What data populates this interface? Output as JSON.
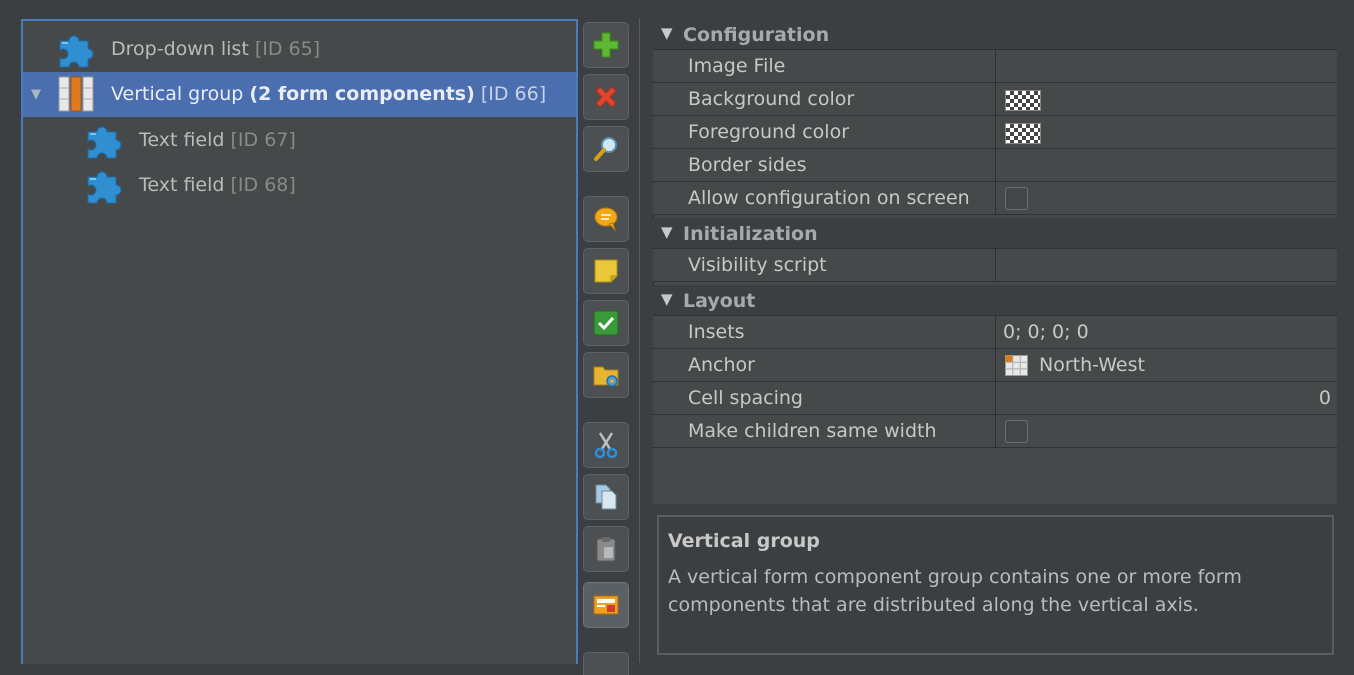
{
  "tree": {
    "items": [
      {
        "label": "Drop-down list",
        "bold": "",
        "id": "[ID 65]",
        "icon": "puzzle-icon",
        "selected": false
      },
      {
        "label": "Vertical group ",
        "bold": "(2 form components)",
        "id": "[ID 66]",
        "icon": "vertical-group-icon",
        "selected": true,
        "expanded": true
      },
      {
        "label": "Text field",
        "bold": "",
        "id": "[ID 67]",
        "icon": "puzzle-icon",
        "selected": false
      },
      {
        "label": "Text field",
        "bold": "",
        "id": "[ID 68]",
        "icon": "puzzle-icon",
        "selected": false
      }
    ]
  },
  "toolbar": {
    "buttons": [
      {
        "name": "add-button",
        "icon": "plus-icon"
      },
      {
        "name": "delete-button",
        "icon": "x-icon"
      },
      {
        "name": "search-button",
        "icon": "magnifier-icon"
      },
      {
        "name": "comment-button",
        "icon": "speech-bubble-icon"
      },
      {
        "name": "note-button",
        "icon": "sticky-note-icon"
      },
      {
        "name": "check-button",
        "icon": "checkmark-icon"
      },
      {
        "name": "folder-button",
        "icon": "folder-gear-icon"
      },
      {
        "name": "cut-button",
        "icon": "scissors-icon"
      },
      {
        "name": "copy-button",
        "icon": "copy-icon"
      },
      {
        "name": "paste-button",
        "icon": "clipboard-icon"
      },
      {
        "name": "screen-button",
        "icon": "form-preview-icon"
      }
    ]
  },
  "properties": {
    "configuration": {
      "title": "Configuration",
      "image_file": "Image File",
      "background_color": "Background color",
      "foreground_color": "Foreground color",
      "border_sides": "Border sides",
      "allow_configuration": "Allow configuration on screen"
    },
    "initialization": {
      "title": "Initialization",
      "visibility_script": "Visibility script"
    },
    "layout": {
      "title": "Layout",
      "insets_label": "Insets",
      "insets_value": "0; 0; 0; 0",
      "anchor_label": "Anchor",
      "anchor_value": "North-West",
      "cell_spacing_label": "Cell spacing",
      "cell_spacing_value": "0",
      "same_width_label": "Make children same width"
    }
  },
  "description": {
    "title": "Vertical group",
    "text": "A vertical form component group contains one or more form components that are distributed along the vertical axis."
  },
  "colors": {
    "background": "#3c3f41",
    "panel": "#45494a",
    "selection": "#4b6eaf",
    "tree_border": "#4a7bbf"
  }
}
